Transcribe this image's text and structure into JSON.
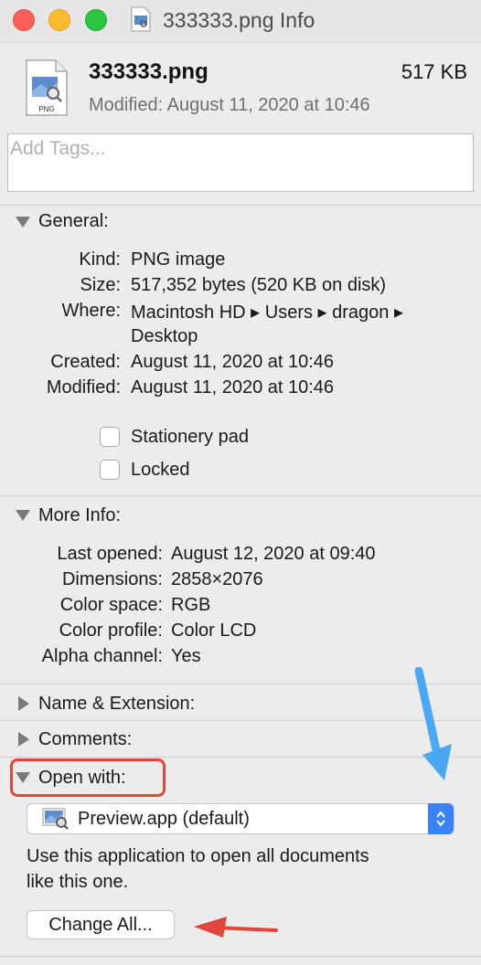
{
  "window": {
    "title": "333333.png Info"
  },
  "header": {
    "file_name": "333333.png",
    "file_size": "517 KB",
    "modified": "Modified: August 11, 2020 at 10:46",
    "icon_label": "PNG"
  },
  "tags": {
    "placeholder": "Add Tags..."
  },
  "general": {
    "title": "General:",
    "rows": [
      {
        "label": "Kind:",
        "value": "PNG image"
      },
      {
        "label": "Size:",
        "value": "517,352 bytes (520 KB on disk)"
      },
      {
        "label": "Where:",
        "value": "Macintosh HD ▸ Users ▸ dragon ▸",
        "value2": "Desktop"
      },
      {
        "label": "Created:",
        "value": "August 11, 2020 at 10:46"
      },
      {
        "label": "Modified:",
        "value": "August 11, 2020 at 10:46"
      }
    ],
    "stationery_label": "Stationery pad",
    "locked_label": "Locked"
  },
  "more_info": {
    "title": "More Info:",
    "rows": [
      {
        "label": "Last opened:",
        "value": "August 12, 2020 at 09:40"
      },
      {
        "label": "Dimensions:",
        "value": "2858×2076"
      },
      {
        "label": "Color space:",
        "value": "RGB"
      },
      {
        "label": "Color profile:",
        "value": "Color LCD"
      },
      {
        "label": "Alpha channel:",
        "value": "Yes"
      }
    ]
  },
  "name_extension": {
    "title": "Name & Extension:"
  },
  "comments": {
    "title": "Comments:"
  },
  "open_with": {
    "title": "Open with:",
    "app": "Preview.app (default)",
    "description_line1": "Use this application to open all documents",
    "description_line2": "like this one.",
    "change_all": "Change All..."
  },
  "colors": {
    "highlight_box": "#e0473a",
    "blue_arrow": "#4aa8f0",
    "red_arrow": "#e0473a"
  }
}
